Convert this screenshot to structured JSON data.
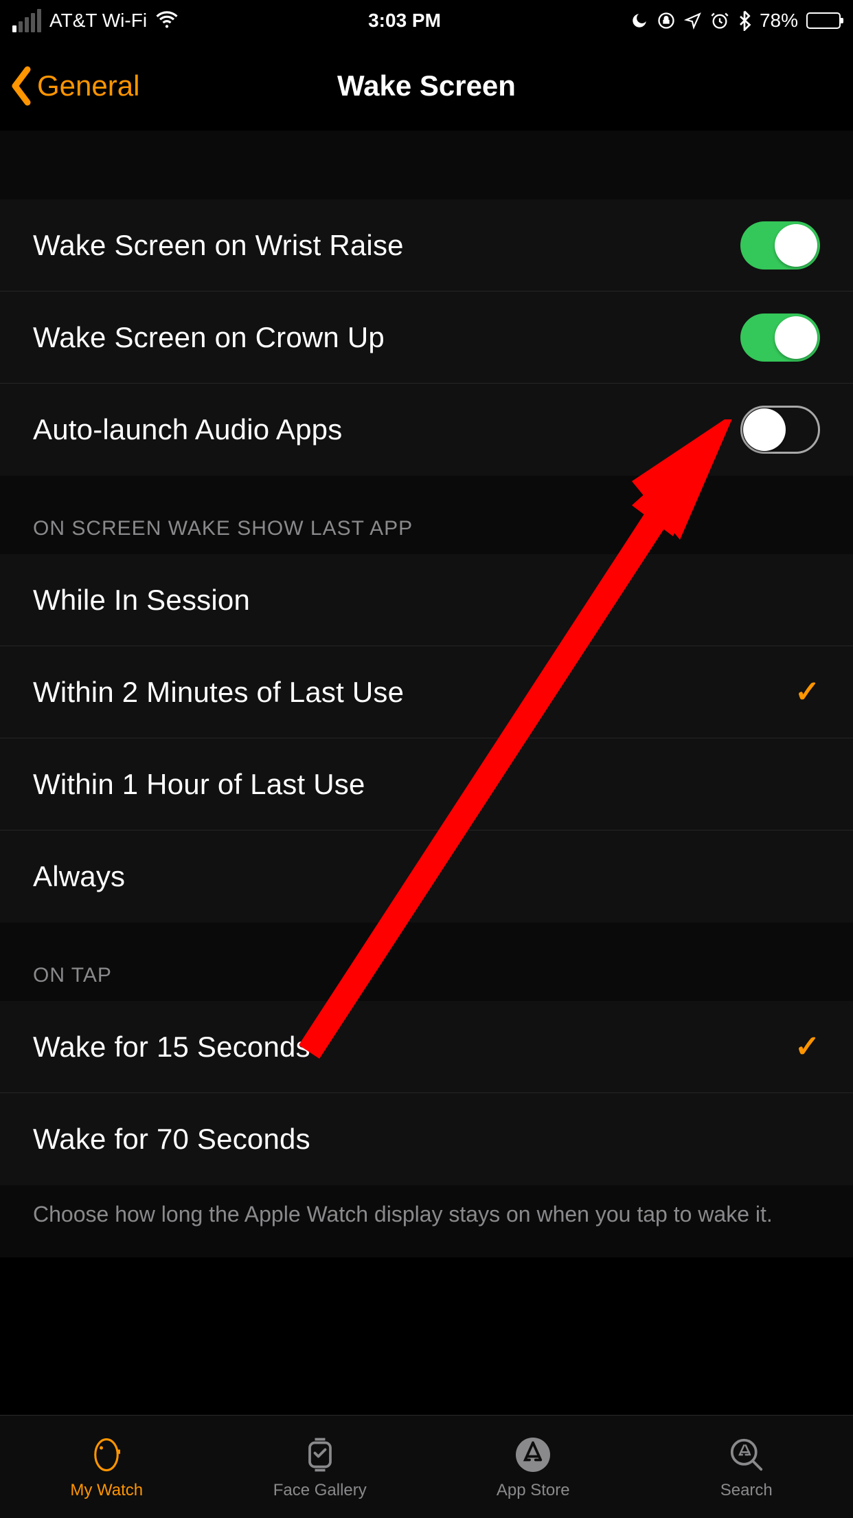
{
  "status": {
    "carrier": "AT&T Wi-Fi",
    "time": "3:03 PM",
    "battery_pct": "78%"
  },
  "nav": {
    "back_label": "General",
    "title": "Wake Screen"
  },
  "toggles": {
    "wrist_raise": {
      "label": "Wake Screen on Wrist Raise",
      "on": true
    },
    "crown_up": {
      "label": "Wake Screen on Crown Up",
      "on": true
    },
    "audio_apps": {
      "label": "Auto-launch Audio Apps",
      "on": false
    }
  },
  "last_app": {
    "header": "ON SCREEN WAKE SHOW LAST APP",
    "options": [
      {
        "label": "While In Session",
        "selected": false
      },
      {
        "label": "Within 2 Minutes of Last Use",
        "selected": true
      },
      {
        "label": "Within 1 Hour of Last Use",
        "selected": false
      },
      {
        "label": "Always",
        "selected": false
      }
    ]
  },
  "on_tap": {
    "header": "ON TAP",
    "options": [
      {
        "label": "Wake for 15 Seconds",
        "selected": true
      },
      {
        "label": "Wake for 70 Seconds",
        "selected": false
      }
    ],
    "footer": "Choose how long the Apple Watch display stays on when you tap to wake it."
  },
  "tabs": {
    "my_watch": "My Watch",
    "face_gallery": "Face Gallery",
    "app_store": "App Store",
    "search": "Search"
  }
}
